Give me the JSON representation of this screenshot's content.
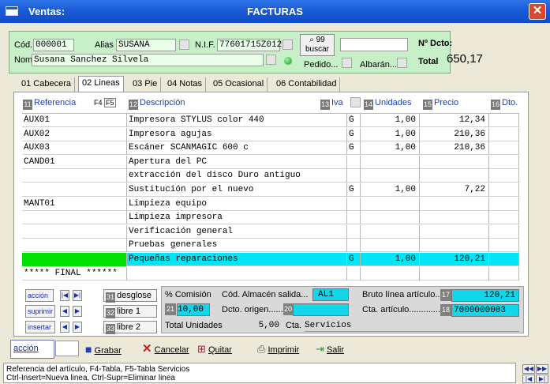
{
  "window": {
    "title_left": "Ventas:",
    "title_center": "FACTURAS",
    "close": "✕"
  },
  "header": {
    "cod_label": "Cód.",
    "cod_value": "000001",
    "alias_label": "Alias",
    "alias_value": "SUSANA",
    "nif_label": "N.I.F.",
    "nif_value": "77601715Z012",
    "nom_label": "Nom.",
    "nom_value": "Susana Sanchez Silvela",
    "buscar_num": "99",
    "buscar_label": "buscar",
    "pedido_label": "Pedido...",
    "albaran_label": "Albarán...",
    "ndcto_label": "Nº Dcto:",
    "total_label": "Total",
    "total_value": "650,17"
  },
  "tabs": [
    "01  Cabecera",
    "02  Lineas",
    "03  Pie",
    "04  Notas",
    "05  Ocasional",
    "06  Contabilidad"
  ],
  "grid": {
    "headers": {
      "ref_num": "11",
      "ref": "Referencia",
      "f4": "F4",
      "f5": "F5",
      "desc_num": "12",
      "desc": "Descripción",
      "iva_num": "13",
      "iva": "Iva",
      "uni_num": "14",
      "uni": "Unidades",
      "precio_num": "15",
      "precio": "Precio",
      "dto_num": "16",
      "dto": "Dto."
    },
    "rows": [
      {
        "ref": "AUX01",
        "desc": "Impresora STYLUS color 440",
        "iva": "G",
        "uni": "1,00",
        "precio": "12,34",
        "dto": ""
      },
      {
        "ref": "AUX02",
        "desc": "Impresora agujas",
        "iva": "G",
        "uni": "1,00",
        "precio": "210,36",
        "dto": ""
      },
      {
        "ref": "AUX03",
        "desc": "Escáner SCANMAGIC 600 c",
        "iva": "G",
        "uni": "1,00",
        "precio": "210,36",
        "dto": ""
      },
      {
        "ref": "CAND01",
        "desc": "Apertura del PC",
        "iva": "",
        "uni": "",
        "precio": "",
        "dto": ""
      },
      {
        "ref": "",
        "desc": "extracción del disco Duro antiguo",
        "iva": "",
        "uni": "",
        "precio": "",
        "dto": ""
      },
      {
        "ref": "",
        "desc": "Sustitución por el nuevo",
        "iva": "G",
        "uni": "1,00",
        "precio": "7,22",
        "dto": ""
      },
      {
        "ref": "MANT01",
        "desc": "Limpieza equipo",
        "iva": "",
        "uni": "",
        "precio": "",
        "dto": ""
      },
      {
        "ref": "",
        "desc": "Limpieza impresora",
        "iva": "",
        "uni": "",
        "precio": "",
        "dto": ""
      },
      {
        "ref": "",
        "desc": "Verificación general",
        "iva": "",
        "uni": "",
        "precio": "",
        "dto": ""
      },
      {
        "ref": "",
        "desc": "Pruebas generales",
        "iva": "",
        "uni": "",
        "precio": "",
        "dto": ""
      },
      {
        "ref": "",
        "desc": "Pequeñas reparaciones",
        "iva": "G",
        "uni": "1,00",
        "precio": "120,21",
        "dto": ""
      },
      {
        "ref": "***** FINAL ******",
        "desc": "",
        "iva": "",
        "uni": "",
        "precio": "",
        "dto": ""
      }
    ]
  },
  "controls": {
    "accion": "acción",
    "suprimir": "suprimir",
    "insertar": "insertar",
    "desglose_num": "31",
    "desglose": "desglose",
    "libre1_num": "32",
    "libre1": "libre 1",
    "libre2_num": "33",
    "libre2": "libre 2",
    "comision_label": "% Comisión",
    "comision_num": "21",
    "comision_value": "10,00",
    "almacen_label": "Cód. Almacén salida...",
    "almacen_value": "AL1",
    "origen_label": "Dcto. origen.......",
    "origen_num": "20",
    "bruto_label": "Bruto línea artículo...",
    "bruto_num": "17",
    "bruto_value": "120,21",
    "cta_art_label": "Cta. artículo...............",
    "cta_art_num": "18",
    "cta_art_value": "7000000003",
    "total_uni_label": "Total Unidades",
    "total_uni_value": "5,00",
    "cta_label": "Cta.",
    "cta_value": "Servicios"
  },
  "toolbar": {
    "accion": "acción",
    "grabar": "Grabar",
    "cancelar": "Cancelar",
    "quitar": "Quitar",
    "imprimir": "Imprimir",
    "salir": "Salir"
  },
  "status": {
    "line1": "Referencia del artículo, F4-Tabla, F5-Tabla Servicios",
    "line2": "Ctrl-Insert=Nueva linea, Ctrl-Supr=Eliminar linea"
  },
  "colors": {
    "titlebar": "#1A5BD6",
    "header_panel": "#C8F0C8",
    "selected_row": "#00E5F5",
    "column_header": "#1A3FB8"
  }
}
